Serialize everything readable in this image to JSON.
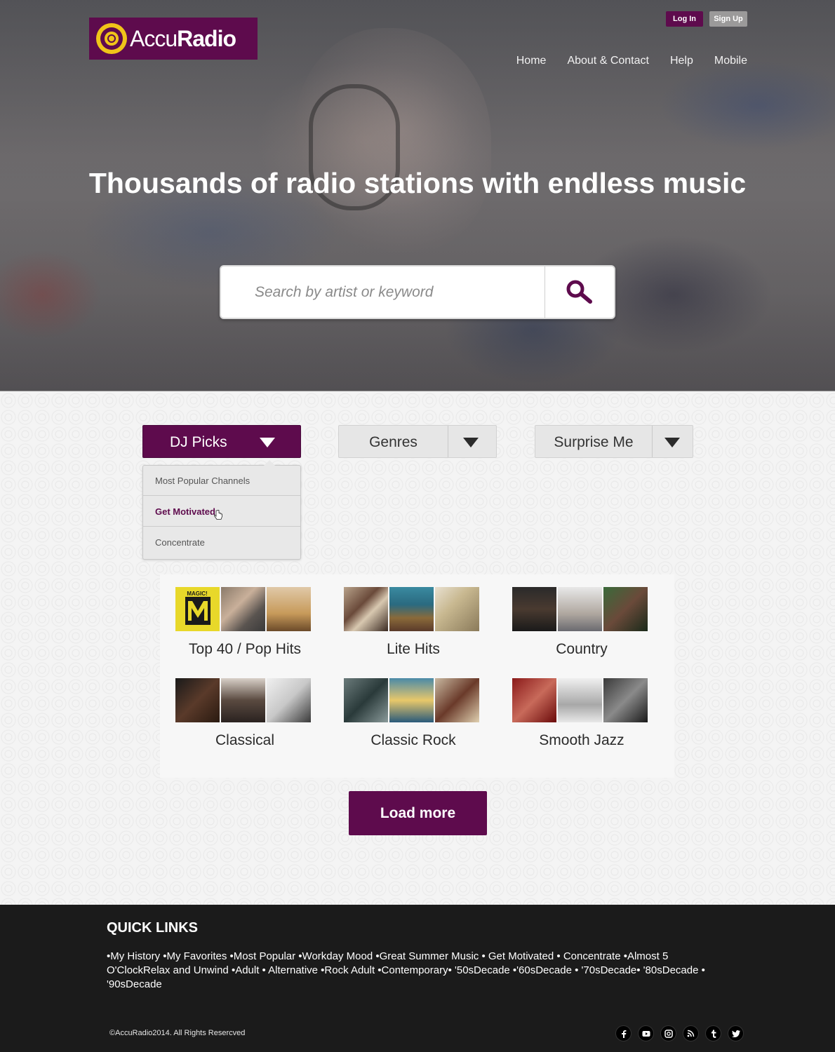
{
  "brand": {
    "name_light": "Accu",
    "name_bold": "Radio"
  },
  "auth": {
    "login_label": "Log In",
    "signup_label": "Sign Up"
  },
  "nav": {
    "items": [
      {
        "label": "Home"
      },
      {
        "label": "About & Contact"
      },
      {
        "label": "Help"
      },
      {
        "label": "Mobile"
      }
    ]
  },
  "hero": {
    "headline": "Thousands of radio stations with endless music"
  },
  "search": {
    "placeholder": "Search by artist or keyword",
    "button_icon": "search-icon"
  },
  "filters": {
    "dj_picks": {
      "label": "DJ Picks",
      "menu": [
        {
          "label": "Most Popular Channels"
        },
        {
          "label": "Get Motivated"
        },
        {
          "label": "Concentrate"
        }
      ]
    },
    "genres": {
      "label": "Genres"
    },
    "surprise": {
      "label": "Surprise Me"
    }
  },
  "genres": [
    {
      "label": "Top 40 / Pop Hits"
    },
    {
      "label": "Lite Hits"
    },
    {
      "label": "Country"
    },
    {
      "label": "Classical"
    },
    {
      "label": "Classic Rock"
    },
    {
      "label": "Smooth Jazz"
    }
  ],
  "load_more_label": "Load more",
  "footer": {
    "title": "QUICK LINKS",
    "links_text": "•My History •My Favorites •Most Popular •Workday Mood •Great Summer Music • Get Motivated • Concentrate •Almost 5 O'ClockRelax and Unwind •Adult • Alternative •Rock Adult •Contemporary•  '50sDecade •'60sDecade • '70sDecade• '80sDecade • '90sDecade",
    "copyright": "©AccuRadio2014. All Rights Resercved",
    "social": [
      "facebook-icon",
      "youtube-icon",
      "instagram-icon",
      "rss-icon",
      "tumblr-icon",
      "twitter-icon"
    ]
  },
  "colors": {
    "brand": "#5e0b4d",
    "accent": "#f0c419",
    "footer_bg": "#1b1b1b"
  }
}
